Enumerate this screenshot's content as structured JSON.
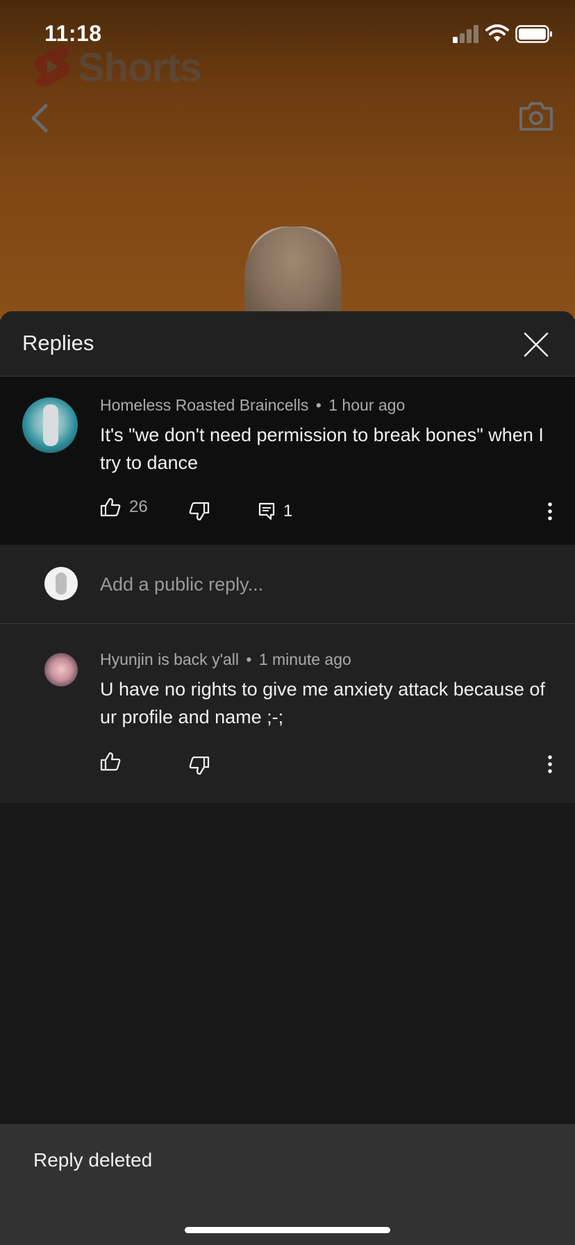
{
  "status_bar": {
    "time": "11:18"
  },
  "video": {
    "logo_text": "Shorts"
  },
  "sheet": {
    "title": "Replies"
  },
  "parent_comment": {
    "author": "Homeless Roasted Braincells",
    "separator": "•",
    "time_ago": "1 hour ago",
    "text": "It's \"we don't need permission to break bones\" when I try to dance",
    "like_count": "26",
    "reply_count": "1"
  },
  "reply_input": {
    "placeholder": "Add a public reply..."
  },
  "reply": {
    "author": "Hyunjin is back y'all",
    "separator": "•",
    "time_ago": "1 minute ago",
    "text": "U have no rights to give me anxiety attack because of ur profile and name  ;-;"
  },
  "snackbar": {
    "message": "Reply deleted"
  },
  "colors": {
    "sheet_bg": "#181818",
    "header_bg": "#212121",
    "parent_bg": "#0f0f0f",
    "snackbar_bg": "#323232",
    "secondary_text": "#aaaaaa"
  }
}
